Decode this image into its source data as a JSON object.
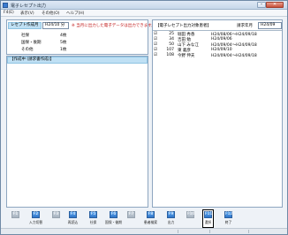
{
  "window": {
    "title": "電子レセプト出力"
  },
  "menu": {
    "items": [
      "F4(E)",
      "表示(V)",
      "その他(O)",
      "ヘルプ(H)"
    ]
  },
  "left": {
    "field_label": "レセプト作成月",
    "field_value": "H24/10 分",
    "note": "※ 当月に出力した電子データは出力できます。",
    "counts": [
      {
        "label": "社保",
        "value": "4枚"
      },
      {
        "label": "国保・後期",
        "value": "5枚"
      },
      {
        "label": "その他",
        "value": "1枚"
      }
    ],
    "pending_header": "【作成中 (請求書作成)】"
  },
  "right": {
    "header": "【電子レセプト出力対象患者】",
    "request_label": "請求年月",
    "request_value": "H24/09",
    "patients": [
      {
        "checked": true,
        "code": "25",
        "name": "堀田 秀香",
        "period": "H24/08/06〜H24/09/18"
      },
      {
        "checked": true,
        "code": "34",
        "name": "吉田 勉",
        "period": "H24/09/06"
      },
      {
        "checked": true,
        "code": "50",
        "name": "山下 みな江",
        "period": "H24/09/04〜H24/09/18"
      },
      {
        "checked": true,
        "code": "107",
        "name": "東 義彦",
        "period": "H24/09/10"
      },
      {
        "checked": true,
        "code": "108",
        "name": "今野 伸夫",
        "period": "H24/09/04〜H24/09/18"
      }
    ]
  },
  "fkeys": [
    {
      "key": "F1",
      "label": "",
      "disabled": true
    },
    {
      "key": "F2",
      "label": "入力切替",
      "disabled": false
    },
    {
      "key": "F3",
      "label": "",
      "disabled": true
    },
    {
      "key": "F4",
      "label": "再読込",
      "disabled": false
    },
    {
      "key": "F5",
      "label": "社保",
      "disabled": false
    },
    {
      "key": "F6",
      "label": "国保・後期",
      "disabled": false
    },
    {
      "key": "F7",
      "label": "",
      "disabled": true
    },
    {
      "key": "F8",
      "label": "患者検索",
      "disabled": false
    },
    {
      "key": "F9",
      "label": "出力",
      "disabled": false
    },
    {
      "key": "F10",
      "label": "",
      "disabled": true
    },
    {
      "key": "F11",
      "label": "選択",
      "disabled": false,
      "selected": true
    },
    {
      "key": "F12",
      "label": "終了",
      "disabled": false
    }
  ]
}
